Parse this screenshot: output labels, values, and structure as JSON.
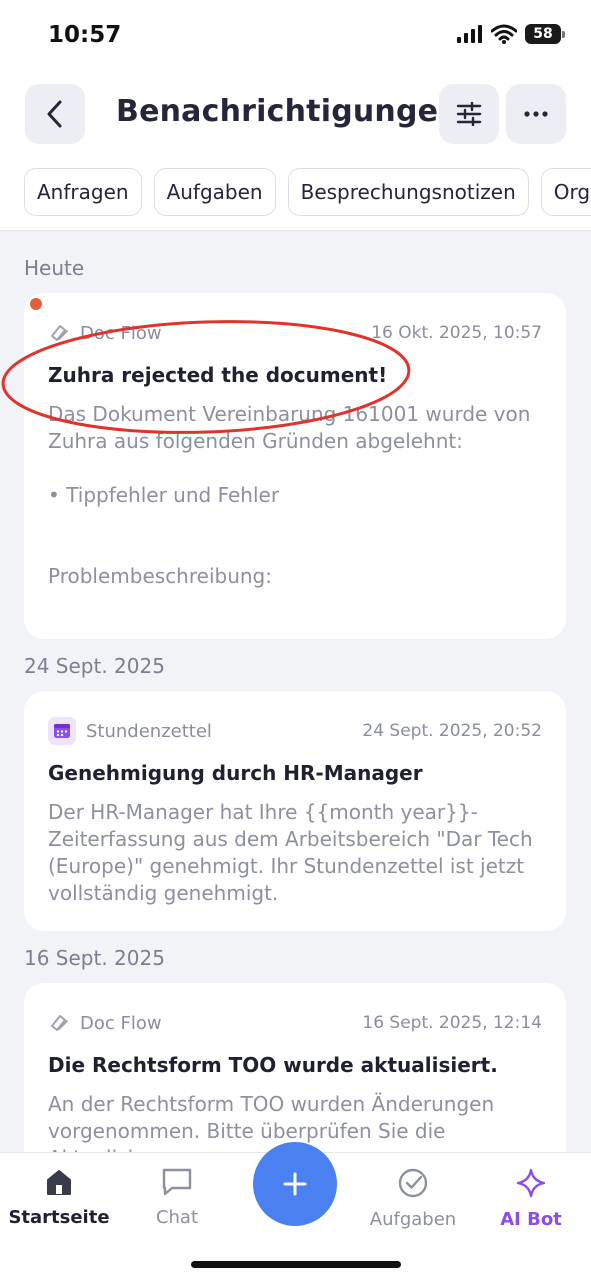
{
  "status": {
    "time": "10:57",
    "battery": "58"
  },
  "header": {
    "title": "Benachrichtigungen"
  },
  "filters": [
    "Anfragen",
    "Aufgaben",
    "Besprechungsnotizen",
    "Org"
  ],
  "sections": [
    {
      "label": "Heute",
      "card": {
        "source": "Doc Flow",
        "source_icon": "doc-flow-icon",
        "time": "16 Okt. 2025, 10:57",
        "title": "Zuhra rejected the document!",
        "body": "Das Dokument Vereinbarung 161001 wurde von Zuhra aus folgenden Gründen abgelehnt:\n\n• Tippfehler und Fehler\n\n\nProblembeschreibung:",
        "unread": true
      }
    },
    {
      "label": "24 Sept. 2025",
      "card": {
        "source": "Stundenzettel",
        "source_icon": "calendar-icon",
        "time": "24 Sept. 2025, 20:52",
        "title": "Genehmigung durch HR-Manager",
        "body": "Der HR-Manager hat Ihre {{month year}}-Zeiterfassung aus dem Arbeitsbereich \"Dar Tech (Europe)\" genehmigt. Ihr Stundenzettel ist jetzt vollständig genehmigt."
      }
    },
    {
      "label": "16 Sept. 2025",
      "card": {
        "source": "Doc Flow",
        "source_icon": "doc-flow-icon",
        "time": "16 Sept. 2025, 12:14",
        "title": "Die Rechtsform TOO wurde aktualisiert.",
        "body": "An der Rechtsform TOO wurden Änderungen vorgenommen. Bitte überprüfen Sie die Aktualisi..."
      }
    }
  ],
  "tabbar": {
    "home": "Startseite",
    "chat": "Chat",
    "tasks": "Aufgaben",
    "ai": "AI Bot"
  },
  "colors": {
    "accent": "#4a80f0",
    "ai_purple": "#8b4ee8",
    "unread_dot": "#e2603b",
    "annotation_red": "#e0332b"
  }
}
